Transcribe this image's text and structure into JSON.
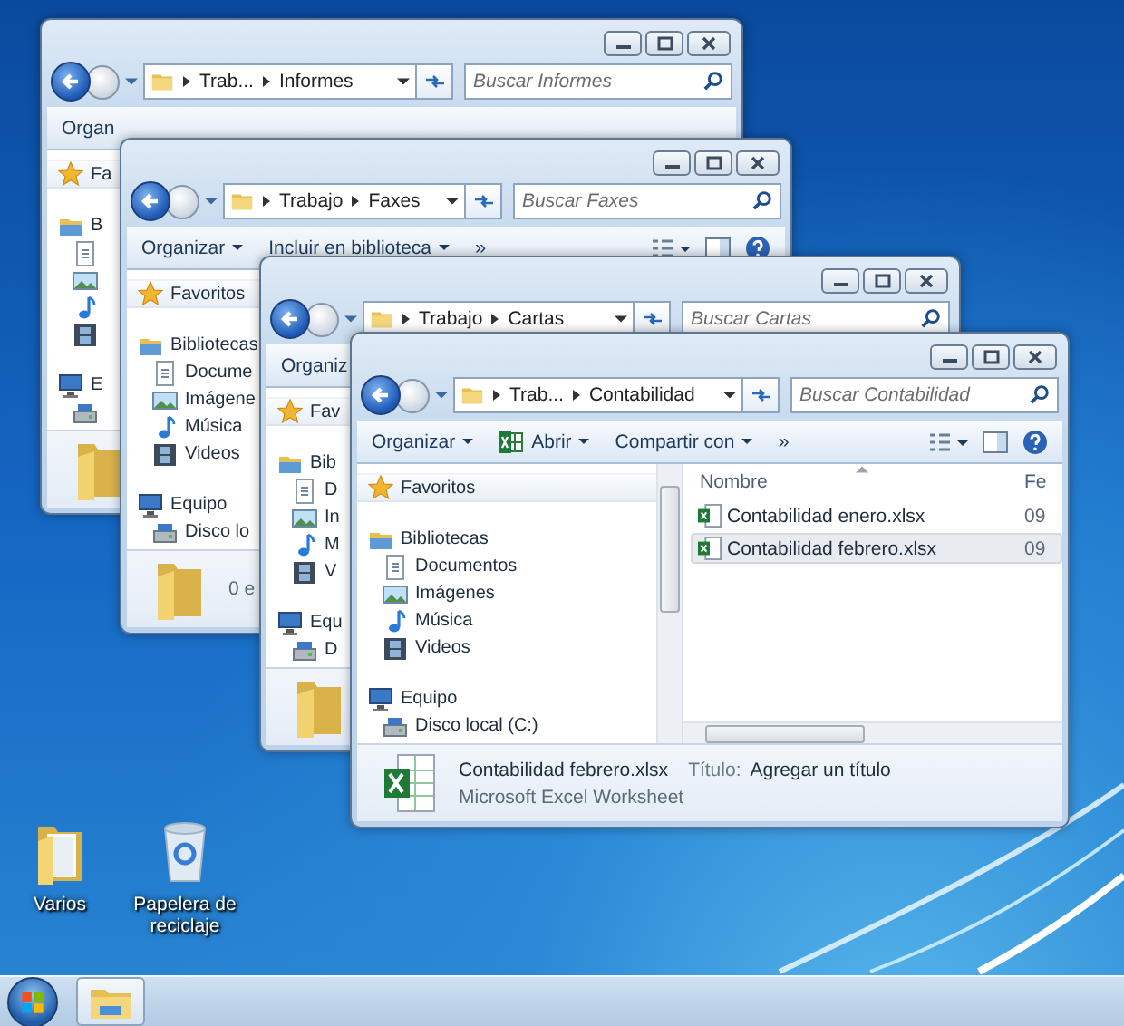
{
  "desktop": {
    "icons": [
      {
        "kind": "folder",
        "label": "Varios"
      },
      {
        "kind": "recycle_bin",
        "label": "Papelera de reciclaje"
      }
    ]
  },
  "windows": [
    {
      "breadcrumb": [
        "Trab...",
        "Informes"
      ],
      "search": {
        "placeholder": "Buscar Informes"
      },
      "toolbar": {
        "items": [
          {
            "kind": "menu",
            "label": "Organ",
            "dropdown": false
          }
        ],
        "view_controls": false
      },
      "nav_pane": [
        {
          "kind": "favorites",
          "label": "Fa"
        },
        {
          "kind": "libraries",
          "label": "B",
          "children": [
            {
              "kind": "documents"
            },
            {
              "kind": "pictures"
            },
            {
              "kind": "music"
            },
            {
              "kind": "videos"
            }
          ]
        },
        {
          "kind": "computer",
          "label": "E",
          "children": [
            {
              "kind": "disk"
            }
          ]
        }
      ],
      "details": {
        "kind": "folder"
      }
    },
    {
      "breadcrumb": [
        "Trabajo",
        "Faxes"
      ],
      "search": {
        "placeholder": "Buscar Faxes"
      },
      "toolbar": {
        "items": [
          {
            "kind": "menu",
            "label": "Organizar",
            "dropdown": true
          },
          {
            "kind": "menu",
            "label": "Incluir en biblioteca",
            "dropdown": true
          },
          {
            "kind": "overflow",
            "label": "»",
            "dropdown": false
          }
        ],
        "view_controls": true
      },
      "nav_pane": [
        {
          "kind": "favorites",
          "label": "Favoritos"
        },
        {
          "kind": "libraries",
          "label": "Bibliotecas",
          "children": [
            {
              "kind": "documents",
              "label": "Docume"
            },
            {
              "kind": "pictures",
              "label": "Imágene"
            },
            {
              "kind": "music",
              "label": "Música"
            },
            {
              "kind": "videos",
              "label": "Videos"
            }
          ]
        },
        {
          "kind": "computer",
          "label": "Equipo",
          "children": [
            {
              "kind": "disk",
              "label": "Disco lo"
            }
          ]
        }
      ],
      "details": {
        "kind": "folder",
        "summary": "0 e"
      }
    },
    {
      "breadcrumb": [
        "Trabajo",
        "Cartas"
      ],
      "search": {
        "placeholder": "Buscar Cartas"
      },
      "toolbar": {
        "items": [
          {
            "kind": "menu",
            "label": "Organiz",
            "dropdown": false
          }
        ],
        "view_controls": false
      },
      "nav_pane": [
        {
          "kind": "favorites",
          "label": "Fav"
        },
        {
          "kind": "libraries",
          "label": "Bib",
          "children": [
            {
              "kind": "documents",
              "label": "D"
            },
            {
              "kind": "pictures",
              "label": "In"
            },
            {
              "kind": "music",
              "label": "M"
            },
            {
              "kind": "videos",
              "label": "V"
            }
          ]
        },
        {
          "kind": "computer",
          "label": "Equ",
          "children": [
            {
              "kind": "disk",
              "label": "D"
            }
          ]
        }
      ],
      "details": {
        "kind": "folder"
      }
    },
    {
      "breadcrumb": [
        "Trab...",
        "Contabilidad"
      ],
      "search": {
        "placeholder": "Buscar Contabilidad"
      },
      "toolbar": {
        "items": [
          {
            "kind": "menu",
            "label": "Organizar",
            "dropdown": true
          },
          {
            "kind": "open",
            "label": "Abrir",
            "dropdown": true
          },
          {
            "kind": "menu",
            "label": "Compartir con",
            "dropdown": true
          },
          {
            "kind": "overflow",
            "label": "»",
            "dropdown": false
          }
        ],
        "view_controls": true
      },
      "nav_pane": [
        {
          "kind": "favorites",
          "label": "Favoritos"
        },
        {
          "kind": "libraries",
          "label": "Bibliotecas",
          "children": [
            {
              "kind": "documents",
              "label": "Documentos"
            },
            {
              "kind": "pictures",
              "label": "Imágenes"
            },
            {
              "kind": "music",
              "label": "Música"
            },
            {
              "kind": "videos",
              "label": "Videos"
            }
          ]
        },
        {
          "kind": "computer",
          "label": "Equipo",
          "children": [
            {
              "kind": "disk",
              "label": "Disco local (C:)"
            }
          ]
        }
      ],
      "files": {
        "columns": [
          "Nombre",
          "Fe"
        ],
        "rows": [
          {
            "name": "Contabilidad enero.xlsx",
            "date": "09",
            "selected": false
          },
          {
            "name": "Contabilidad febrero.xlsx",
            "date": "09",
            "selected": true
          }
        ]
      },
      "details": {
        "kind": "excel",
        "name": "Contabilidad febrero.xlsx",
        "property_label": "Título:",
        "property_value": "Agregar un título",
        "type": "Microsoft Excel Worksheet"
      }
    }
  ],
  "taskbar": {
    "buttons": [
      {
        "kind": "explorer",
        "selected": true
      }
    ]
  }
}
